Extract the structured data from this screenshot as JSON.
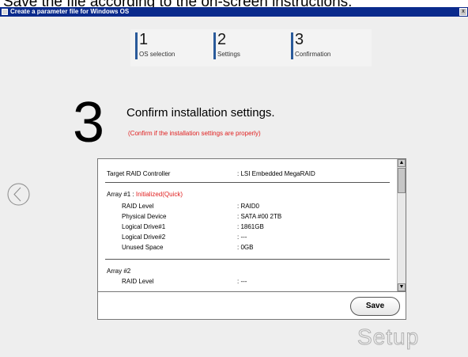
{
  "caption": "Save the file according to the on-screen instructions.",
  "window": {
    "title": "Create a parameter file for Windows OS",
    "close_glyph": "x"
  },
  "steps": [
    {
      "number": "1",
      "label": "OS selection"
    },
    {
      "number": "2",
      "label": "Settings"
    },
    {
      "number": "3",
      "label": "Confirmation"
    }
  ],
  "current_step_number": "3",
  "heading": "Confirm installation settings.",
  "subheading": "(Confirm if the installation settings are properly)",
  "settings": {
    "controller_label": "Target RAID Controller",
    "controller_value": ": LSI Embedded MegaRAID",
    "array1_title": "Array #1 : ",
    "array1_status": "Initialized(Quick)",
    "array1_rows": [
      {
        "label": "RAID Level",
        "value": ": RAID0"
      },
      {
        "label": "Physical Device",
        "value": ": SATA #00 2TB"
      },
      {
        "label": "Logical Drive#1",
        "value": ": 1861GB"
      },
      {
        "label": "Logical Drive#2",
        "value": ": ---"
      },
      {
        "label": "Unused Space",
        "value": ": 0GB"
      }
    ],
    "array2_title": "Array #2",
    "array2_rows": [
      {
        "label": "RAID Level",
        "value": ": ---"
      }
    ]
  },
  "scrollbar": {
    "up_glyph": "▲",
    "down_glyph": "▼"
  },
  "save_label": "Save",
  "watermark": "Setup",
  "colors": {
    "titlebar": "#0a2a8c",
    "accent_red": "#e02020",
    "step_bar": "#2a5a9a",
    "window_bg": "#eeeeee"
  }
}
